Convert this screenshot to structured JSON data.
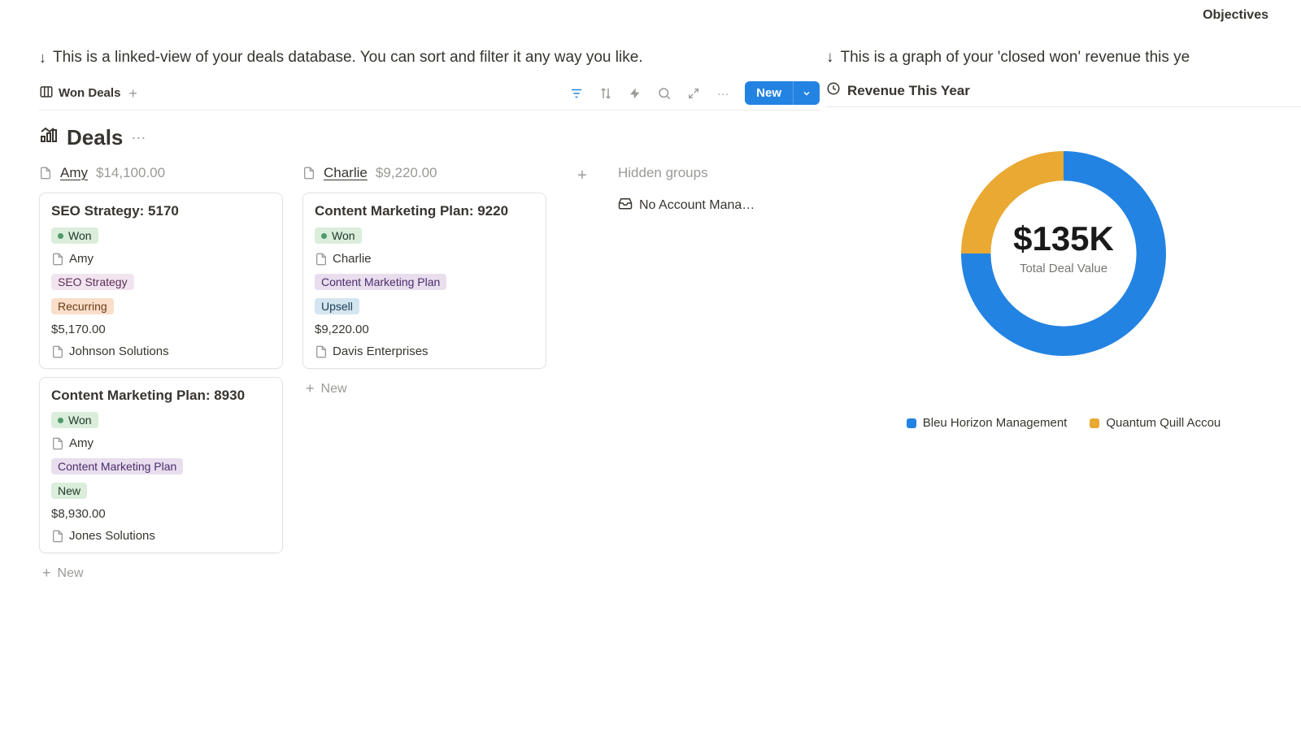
{
  "top_nav": {
    "objectives": "Objectives"
  },
  "left": {
    "hint": "This is a linked-view of your deals database. You can sort and filter it any way you like.",
    "view": {
      "tab_label": "Won Deals",
      "new_btn": "New"
    },
    "deals": {
      "title": "Deals"
    },
    "columns": [
      {
        "name": "Amy",
        "amount": "$14,100.00",
        "cards": [
          {
            "title": "SEO Strategy: 5170",
            "status": "Won",
            "owner": "Amy",
            "category": "SEO Strategy",
            "category_kind": "seo",
            "deal_type": "Recurring",
            "deal_type_kind": "recurring",
            "amount": "$5,170.00",
            "company": "Johnson Solutions"
          },
          {
            "title": "Content Marketing Plan: 8930",
            "status": "Won",
            "owner": "Amy",
            "category": "Content Marketing Plan",
            "category_kind": "content",
            "deal_type": "New",
            "deal_type_kind": "new",
            "amount": "$8,930.00",
            "company": "Jones Solutions"
          }
        ]
      },
      {
        "name": "Charlie",
        "amount": "$9,220.00",
        "cards": [
          {
            "title": "Content Marketing Plan: 9220",
            "status": "Won",
            "owner": "Charlie",
            "category": "Content Marketing Plan",
            "category_kind": "content",
            "deal_type": "Upsell",
            "deal_type_kind": "upsell",
            "amount": "$9,220.00",
            "company": "Davis Enterprises"
          }
        ]
      }
    ],
    "hidden_header": "Hidden groups",
    "hidden_items": [
      "No Account Mana…"
    ],
    "new_label": "New"
  },
  "right": {
    "hint": "This is a graph of your 'closed won' revenue this ye",
    "chart_title": "Revenue This Year",
    "center_value": "$135K",
    "center_label": "Total Deal Value",
    "legend": [
      {
        "label": "Bleu Horizon Management",
        "swatch": "sw-blue"
      },
      {
        "label": "Quantum Quill Accou",
        "swatch": "sw-yellow"
      }
    ]
  },
  "chart_data": {
    "type": "pie",
    "title": "Revenue This Year",
    "center_label": "Total Deal Value",
    "center_value_text": "$135K",
    "total": 135000,
    "series": [
      {
        "name": "Bleu Horizon Management",
        "value": 101250,
        "color": "#2383e2"
      },
      {
        "name": "Quantum Quill Accou",
        "value": 33750,
        "color": "#e9a932"
      }
    ]
  }
}
